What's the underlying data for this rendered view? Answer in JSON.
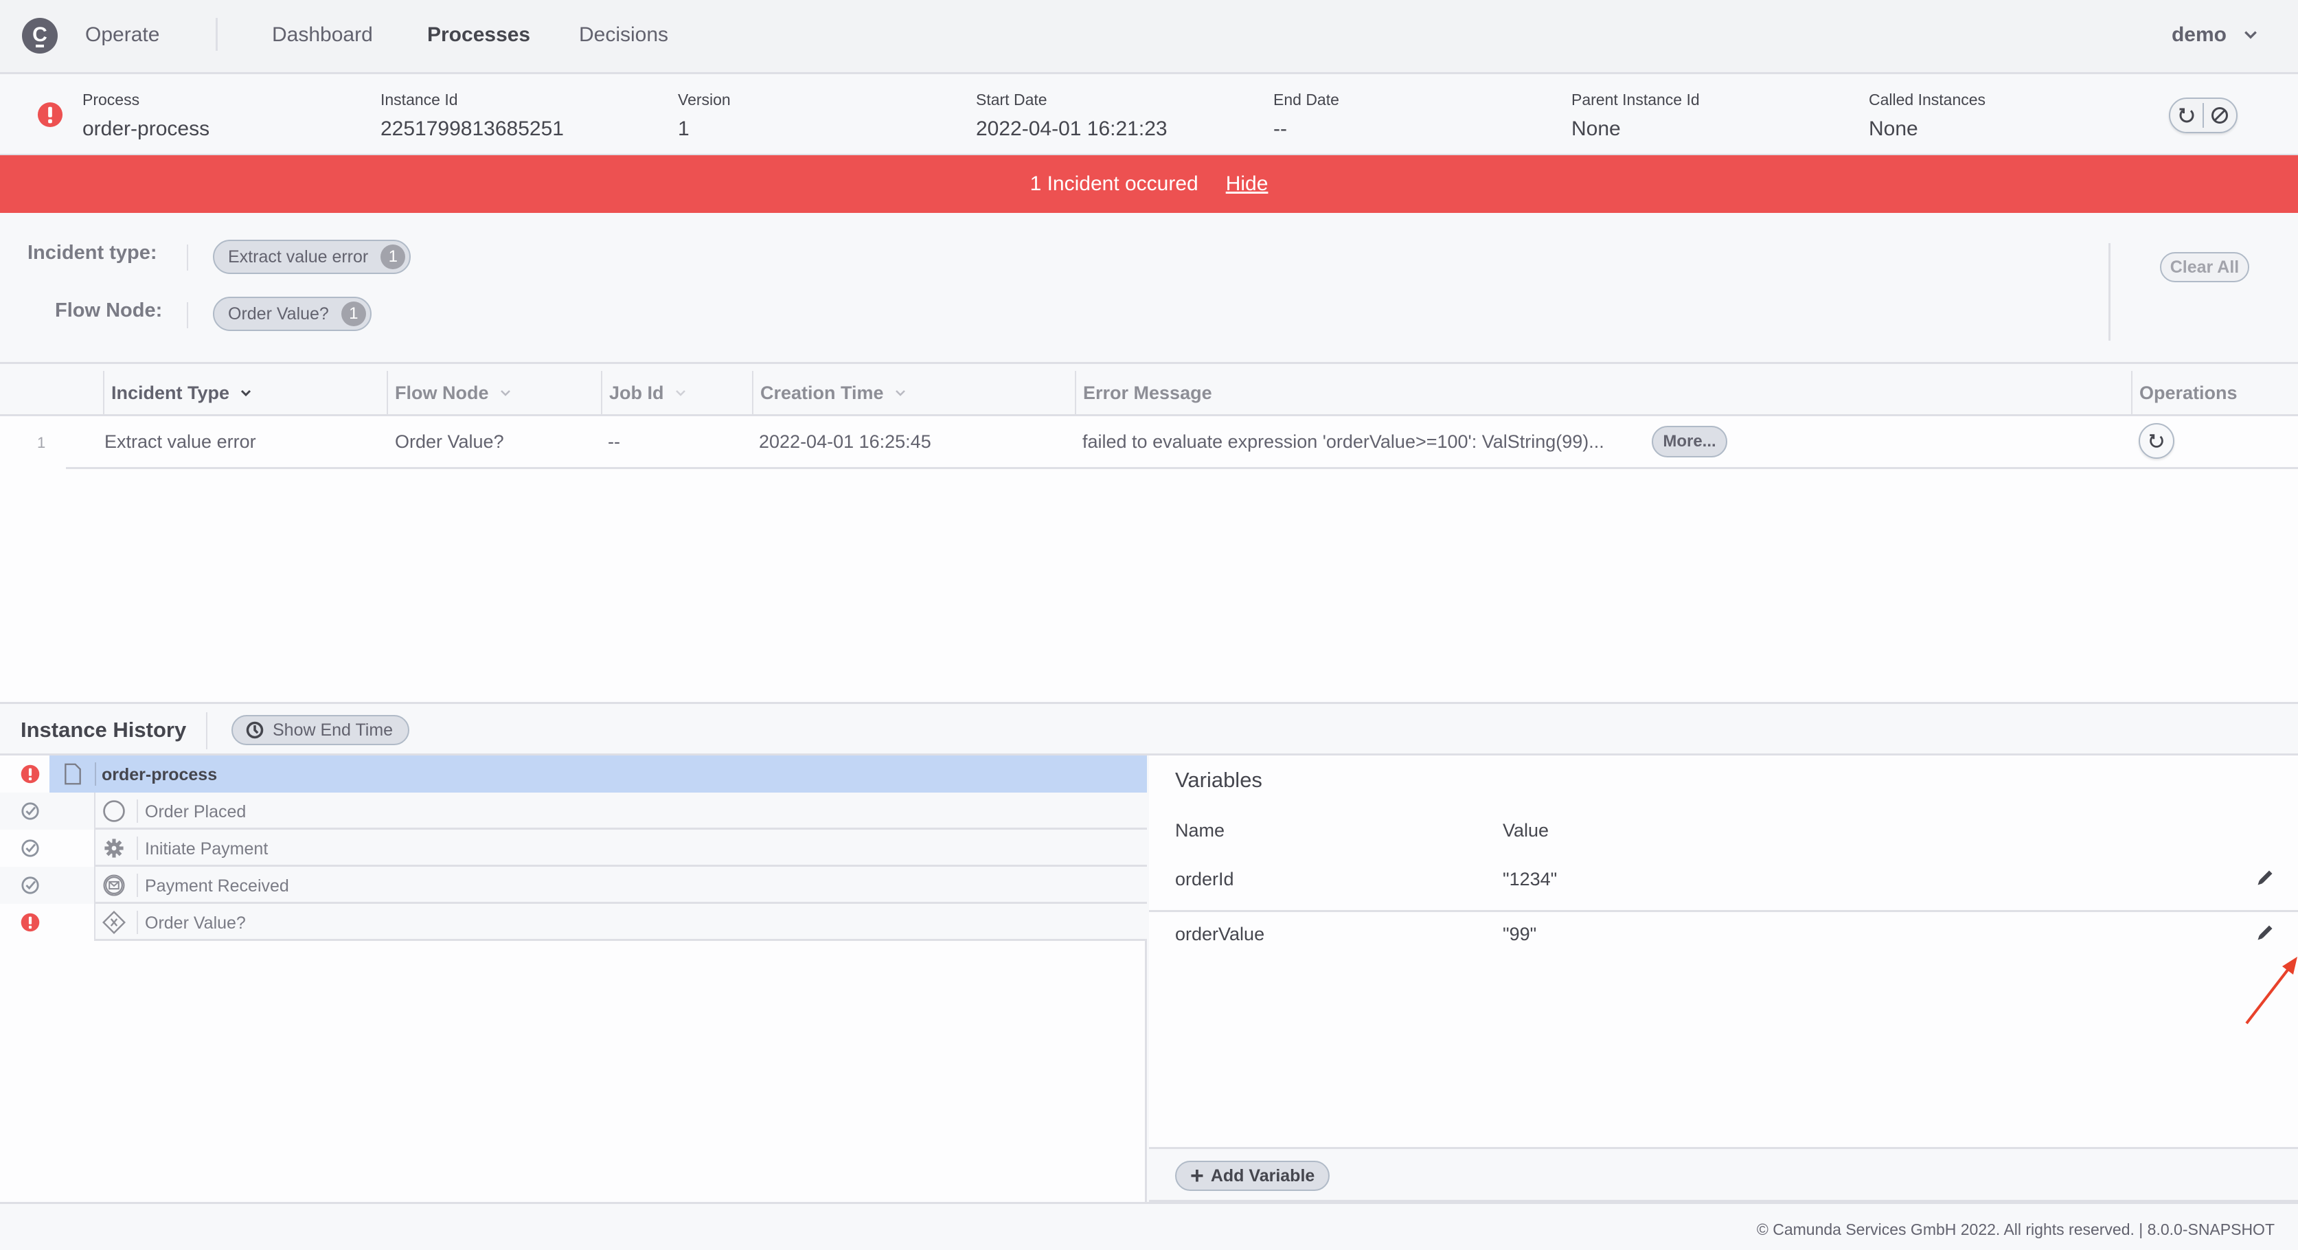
{
  "nav": {
    "app_name": "Operate",
    "links": [
      {
        "label": "Dashboard",
        "active": false
      },
      {
        "label": "Processes",
        "active": true
      },
      {
        "label": "Decisions",
        "active": false
      }
    ],
    "user": "demo"
  },
  "instance": {
    "state_icon": "incident-icon",
    "fields": [
      {
        "label": "Process",
        "value": "order-process"
      },
      {
        "label": "Instance Id",
        "value": "2251799813685251"
      },
      {
        "label": "Version",
        "value": "1"
      },
      {
        "label": "Start Date",
        "value": "2022-04-01 16:21:23"
      },
      {
        "label": "End Date",
        "value": "--"
      },
      {
        "label": "Parent Instance Id",
        "value": "None"
      },
      {
        "label": "Called Instances",
        "value": "None"
      }
    ],
    "operations": [
      "retry-icon",
      "cancel-icon"
    ]
  },
  "banner": {
    "text": "1 Incident occured",
    "hide_label": "Hide",
    "color": "#ed5151"
  },
  "filters": {
    "incident_type_label": "Incident type:",
    "incident_type_pills": [
      {
        "label": "Extract value error",
        "count": "1"
      }
    ],
    "flow_node_label": "Flow Node:",
    "flow_node_pills": [
      {
        "label": "Order Value?",
        "count": "1"
      }
    ],
    "clear_all_label": "Clear All"
  },
  "incidents_table": {
    "columns": [
      "Incident Type",
      "Flow Node",
      "Job Id",
      "Creation Time",
      "Error Message",
      "Operations"
    ],
    "rows": [
      {
        "index": "1",
        "incident_type": "Extract value error",
        "flow_node": "Order Value?",
        "job_id": "--",
        "creation_time": "2022-04-01 16:25:45",
        "error_message": "failed to evaluate expression 'orderValue>=100': ValString(99)...",
        "more_label": "More..."
      }
    ]
  },
  "history": {
    "title": "Instance History",
    "show_end_time_label": "Show End Time",
    "nodes": [
      {
        "label": "order-process",
        "status": "incident",
        "type": "process",
        "selected": true
      },
      {
        "label": "Order Placed",
        "status": "completed",
        "type": "start-event"
      },
      {
        "label": "Initiate Payment",
        "status": "completed",
        "type": "service-task"
      },
      {
        "label": "Payment Received",
        "status": "completed",
        "type": "message-catch-event"
      },
      {
        "label": "Order Value?",
        "status": "incident",
        "type": "exclusive-gateway"
      }
    ]
  },
  "variables": {
    "title": "Variables",
    "name_header": "Name",
    "value_header": "Value",
    "items": [
      {
        "name": "orderId",
        "value": "\"1234\""
      },
      {
        "name": "orderValue",
        "value": "\"99\""
      }
    ],
    "add_label": "Add Variable"
  },
  "footer": {
    "text": "© Camunda Services GmbH 2022. All rights reserved. | 8.0.0-SNAPSHOT"
  },
  "colors": {
    "incident": "#ed5151",
    "selected_row": "#c2d6f5",
    "annotation_arrow": "#e8412a"
  }
}
